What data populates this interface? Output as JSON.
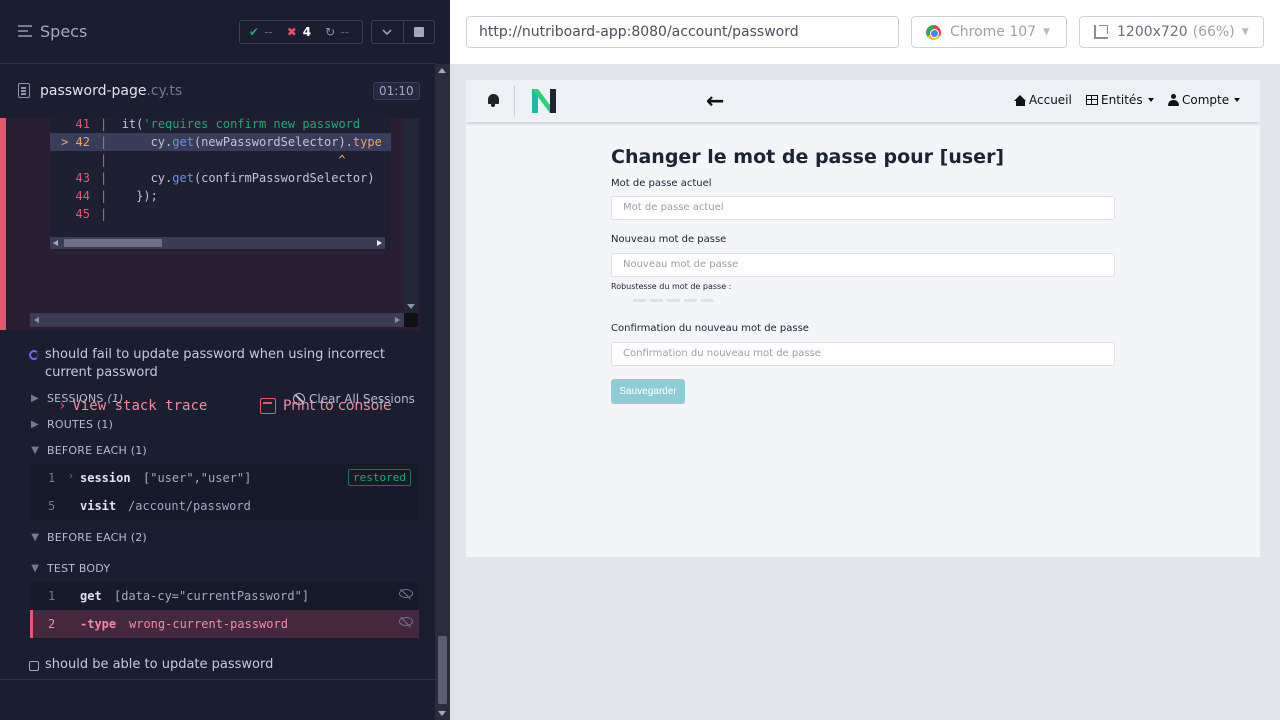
{
  "reporter": {
    "title": "Specs",
    "stats": {
      "passed": "--",
      "failed": "4",
      "pending": "--"
    },
    "spec": {
      "name": "password-page",
      "ext": ".cy.ts",
      "duration": "01:10"
    },
    "code_lines": [
      {
        "num": "41",
        "marker": "",
        "code_parts": [
          [
            "",
            "it"
          ],
          [
            "",
            "("
          ],
          [
            "str",
            "'requires confirm new password"
          ]
        ]
      },
      {
        "num": "42",
        "marker": "> ",
        "highlight": true,
        "code_parts": [
          [
            "",
            "    cy."
          ],
          [
            "fn",
            "get"
          ],
          [
            "",
            "(newPasswordSelector)."
          ],
          [
            "arrow",
            "typ"
          ],
          [
            "arrow",
            "e"
          ]
        ]
      },
      {
        "num": "",
        "marker": "",
        "code_parts": [
          [
            "arrow",
            "                              ^"
          ]
        ]
      },
      {
        "num": "43",
        "marker": "",
        "code_parts": [
          [
            "",
            "    cy."
          ],
          [
            "fn",
            "get"
          ],
          [
            "",
            "(confirmPasswordSelector)"
          ]
        ]
      },
      {
        "num": "44",
        "marker": "",
        "code_parts": [
          [
            "",
            "  });"
          ]
        ]
      },
      {
        "num": "45",
        "marker": "",
        "code_parts": [
          [
            "",
            ""
          ]
        ]
      }
    ],
    "view_stack_trace": "View stack trace",
    "print_to_console": "Print to console",
    "running_test": "should fail to update password when using incorrect current password",
    "sessions_label": "SESSIONS",
    "sessions_count": "(1)",
    "clear_sessions": "Clear All Sessions",
    "routes_label": "ROUTES (1)",
    "before_each_1": "BEFORE EACH (1)",
    "before_each_2": "BEFORE EACH (2)",
    "test_body": "TEST BODY",
    "be1_commands": [
      {
        "num": "1",
        "name": "session",
        "message": "[\"user\",\"user\"]",
        "badge": "restored"
      },
      {
        "num": "5",
        "name": "visit",
        "message": "/account/password"
      }
    ],
    "body_commands": [
      {
        "num": "1",
        "name": "get",
        "message": "[data-cy=\"currentPassword\"]"
      },
      {
        "num": "2",
        "name": "-type",
        "message": "wrong-current-password",
        "state": "failed"
      }
    ],
    "next_test": "should be able to update password"
  },
  "browser": {
    "url": "http://nutriboard-app:8080/account/password",
    "browser_name": "Chrome 107",
    "viewport": "1200x720",
    "zoom": "(66%)"
  },
  "app": {
    "nav": {
      "home": "Accueil",
      "entities": "Entités",
      "account": "Compte"
    },
    "form": {
      "title": "Changer le mot de passe pour [user]",
      "current_label": "Mot de passe actuel",
      "current_placeholder": "Mot de passe actuel",
      "new_label": "Nouveau mot de passe",
      "new_placeholder": "Nouveau mot de passe",
      "strength_label": "Robustesse du mot de passe :",
      "confirm_label": "Confirmation du nouveau mot de passe",
      "confirm_placeholder": "Confirmation du nouveau mot de passe",
      "save": "Sauvegarder"
    }
  },
  "colors": {
    "fail": "#e45770",
    "pass": "#1fa971",
    "save_button": "#8ecdd5",
    "logo_teal": "#1fb7a8",
    "logo_dark": "#1c2333"
  }
}
